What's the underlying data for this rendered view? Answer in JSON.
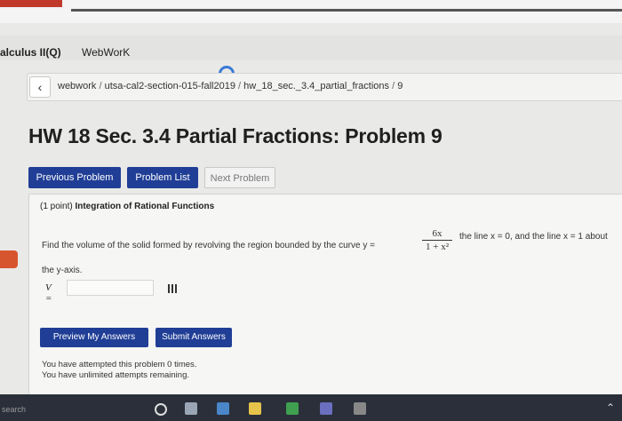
{
  "tabs": [
    "alculus II(Q)",
    "WebWorK"
  ],
  "breadcrumb": {
    "back_icon": "chevron-left-icon",
    "items": [
      "webwork",
      "utsa-cal2-section-015-fall2019",
      "hw_18_sec._3.4_partial_fractions",
      "9"
    ],
    "separator": "/"
  },
  "page_title": "HW 18 Sec. 3.4 Partial Fractions: Problem 9",
  "nav_buttons": {
    "previous": "Previous Problem",
    "list": "Problem List",
    "next": "Next Problem"
  },
  "problem": {
    "points": "(1 point)",
    "topic": "Integration of Rational Functions",
    "statement_prefix": "Find the volume of the solid formed by revolving the region bounded by the curve y =",
    "fraction_numerator": "6x",
    "fraction_denominator": "1 + x²",
    "statement_suffix": "the line x = 0, and the line x = 1 about",
    "statement_line2": "the y-axis.",
    "answer_label": "V =",
    "answer_value": ""
  },
  "actions": {
    "preview": "Preview My Answers",
    "submit": "Submit Answers"
  },
  "attempts": {
    "line1": "You have attempted this problem 0 times.",
    "line2": "You have unlimited attempts remaining."
  },
  "taskbar": {
    "search_text": "search"
  },
  "colors": {
    "primary_button": "#203e96",
    "accent_orange": "#d7552e"
  }
}
